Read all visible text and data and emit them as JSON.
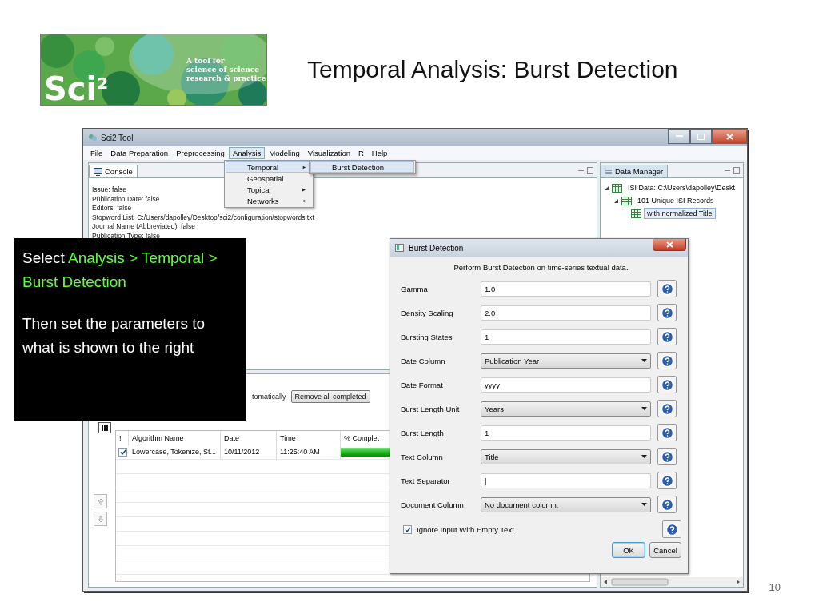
{
  "slide": {
    "title": "Temporal Analysis: Burst Detection",
    "page_number": "10"
  },
  "logo": {
    "mark": "Sci$^{2}$",
    "tagline": [
      "A tool for",
      "science of science",
      "research & practice"
    ]
  },
  "window": {
    "title": "Sci2 Tool"
  },
  "menu_bar": [
    {
      "label": "File",
      "selected": false
    },
    {
      "label": "Data Preparation",
      "selected": false
    },
    {
      "label": "Preprocessing",
      "selected": false
    },
    {
      "label": "Analysis",
      "selected": true
    },
    {
      "label": "Modeling",
      "selected": false
    },
    {
      "label": "Visualization",
      "selected": false
    },
    {
      "label": "R",
      "selected": false
    },
    {
      "label": "Help",
      "selected": false
    }
  ],
  "analysis_menu": [
    {
      "label": "Temporal",
      "selected": true
    },
    {
      "label": "Geospatial",
      "selected": false
    },
    {
      "label": "Topical",
      "selected": false
    },
    {
      "label": "Networks",
      "selected": false
    }
  ],
  "temporal_submenu": [
    {
      "label": "Burst Detection",
      "selected": true
    }
  ],
  "console": {
    "tab": "Console",
    "lines": [
      "Issue: false",
      "Publication Date: false",
      "Editors: false",
      "Stopword List: C:/Users/dapolley/Desktop/sci2/configuration/stopwords.txt",
      "Journal Name (Abbreviated): false",
      "Publication Type: false"
    ]
  },
  "data_manager": {
    "tab": "Data Manager",
    "tree": [
      {
        "label": "ISI Data: C:\\Users\\dapolley\\Deskt",
        "selected": false,
        "expanded": true,
        "children": [
          {
            "label": "101 Unique ISI Records",
            "selected": false,
            "expanded": true,
            "children": [
              {
                "label": "with normalized Title",
                "selected": true
              }
            ]
          }
        ]
      }
    ]
  },
  "scheduler": {
    "auto_remove_label": "tomatically",
    "remove_button": "Remove all completed",
    "columns": [
      "!",
      "Algorithm Name",
      "Date",
      "Time",
      "% Complet"
    ],
    "rows": [
      {
        "checked": true,
        "name": "Lowercase, Tokenize, St...",
        "date": "10/11/2012",
        "time": "11:25:40 AM",
        "level": 1
      }
    ]
  },
  "callout": {
    "prefix": "Select ",
    "path": "Analysis > Temporal > Burst Detection",
    "instruction": "Then set the parameters to what is shown to the right"
  },
  "dialog": {
    "title": "Burst Detection",
    "description": "Perform Burst Detection on time-series textual data.",
    "params": [
      {
        "kind": "text",
        "label": "Gamma",
        "value": "1.0"
      },
      {
        "kind": "text",
        "label": "Density Scaling",
        "value": "2.0"
      },
      {
        "kind": "text",
        "label": "Bursting States",
        "value": "1"
      },
      {
        "kind": "select",
        "label": "Date Column",
        "value": "Publication Year"
      },
      {
        "kind": "text",
        "label": "Date Format",
        "value": "yyyy"
      },
      {
        "kind": "select",
        "label": "Burst Length Unit",
        "value": "Years"
      },
      {
        "kind": "text",
        "label": "Burst Length",
        "value": "1"
      },
      {
        "kind": "select",
        "label": "Text Column",
        "value": "Title"
      },
      {
        "kind": "text",
        "label": "Text Separator",
        "value": "|"
      },
      {
        "kind": "select",
        "label": "Document Column",
        "value": "No document column."
      }
    ],
    "ignore_empty": {
      "label": "Ignore Input With Empty Text",
      "checked": true
    },
    "buttons": [
      {
        "label": "OK",
        "focused": true
      },
      {
        "label": "Cancel",
        "focused": false
      }
    ]
  }
}
